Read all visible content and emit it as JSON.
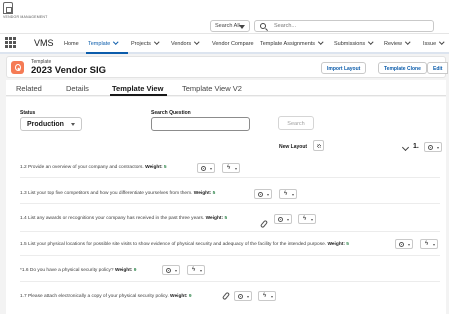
{
  "header": {
    "logo_text": "VENDOR MANAGEMENT",
    "search_scope": "Search All",
    "search_placeholder": "Search..."
  },
  "nav": {
    "app_name": "VMS",
    "items": [
      {
        "label": "Home",
        "chevron": false
      },
      {
        "label": "Template",
        "chevron": true,
        "active": true
      },
      {
        "label": "Projects",
        "chevron": true
      },
      {
        "label": "Vendors",
        "chevron": true
      },
      {
        "label": "Vendor Compare",
        "chevron": false
      },
      {
        "label": "Template Assignments",
        "chevron": true
      },
      {
        "label": "Submissions",
        "chevron": true
      },
      {
        "label": "Review",
        "chevron": true
      },
      {
        "label": "Issue",
        "chevron": true
      }
    ]
  },
  "record": {
    "type_label": "Template",
    "title": "2023 Vendor SIG",
    "buttons": [
      "Import Layout",
      "Template Clone",
      "Edit"
    ],
    "icon": "template-icon",
    "accent": "#f57b55"
  },
  "tabs": [
    "Related",
    "Details",
    "Template View",
    "Template View V2"
  ],
  "filters": {
    "status_label": "Status",
    "status_value": "Production",
    "search_question_label": "Search Question",
    "search_question_value": "",
    "search_button": "Search"
  },
  "layout_bar": {
    "new_layout_label": "New Layout",
    "version_label": "1."
  },
  "questions": [
    {
      "text": "1.2 Provide an overview of your company and contractors.",
      "weight_label": "Weight:",
      "weight": "5",
      "attachment": false
    },
    {
      "text": "1.3 List your top five competitors and how you differentiate yourselves from them.",
      "weight_label": "Weight:",
      "weight": "5",
      "attachment": false
    },
    {
      "text": "1.4 List any awards or recognitions your company has received in the past three years.",
      "weight_label": "Weight:",
      "weight": "5",
      "attachment": true
    },
    {
      "text": "1.5 List your physical locations for possible site visits to show evidence of physical security and adequacy of the facility for the intended purpose.",
      "weight_label": "Weight:",
      "weight": "5",
      "attachment": false
    },
    {
      "text": "*1.6 Do you have a physical security policy?",
      "weight_label": "Weight:",
      "weight": "9",
      "attachment": false
    },
    {
      "text": "1.7 Please attach electronically a copy of your physical security policy.",
      "weight_label": "Weight:",
      "weight": "9",
      "attachment": true
    }
  ],
  "colors": {
    "brand_blue": "#0b5cab",
    "weight_green": "#2e844a"
  }
}
